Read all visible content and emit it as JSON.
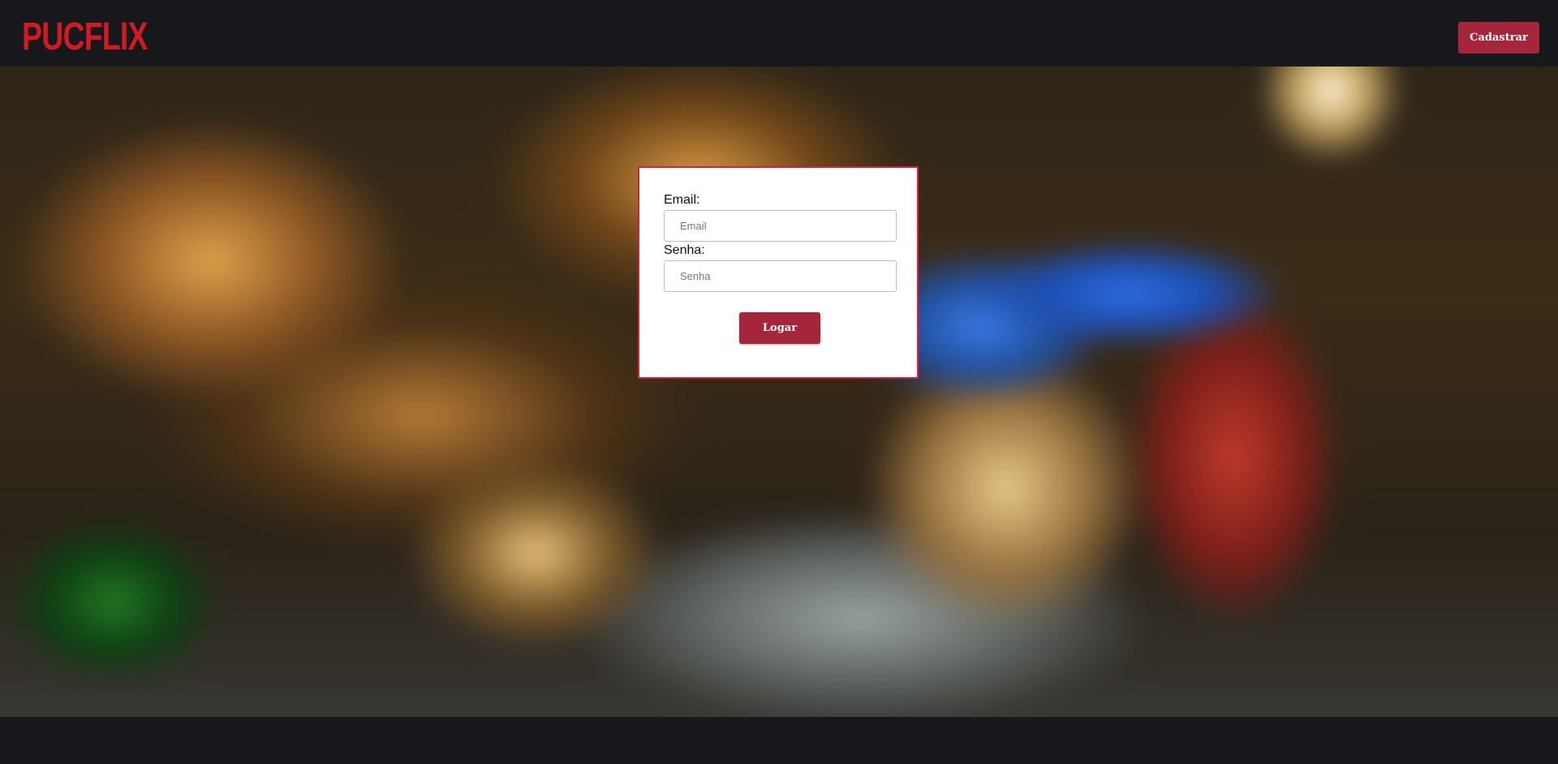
{
  "header": {
    "logo_text": "PUCFLIX",
    "register_label": "Cadastrar"
  },
  "login": {
    "email_label": "Email:",
    "email_placeholder": "Email",
    "email_value": "",
    "password_label": "Senha:",
    "password_placeholder": "Senha",
    "password_value": "",
    "submit_label": "Logar"
  },
  "colors": {
    "brand_red": "#d11b22",
    "button_bg": "#a5263a",
    "card_border": "#d8203c",
    "page_bg": "#17181c"
  }
}
